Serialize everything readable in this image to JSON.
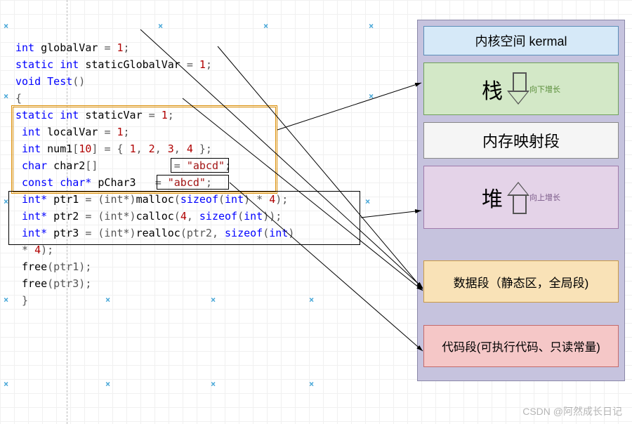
{
  "code": {
    "l1_kw1": "int",
    "l1_var": " globalVar ",
    "l1_eq": "=",
    "l1_num": " 1",
    "l1_semi": ";",
    "l2_kw1": "static int",
    "l2_var": " staticGlobalVar ",
    "l2_eq": "=",
    "l2_num": " 1",
    "l2_semi": ";",
    "l3_kw": "void ",
    "l3_fn": "Test",
    "l3_par": "()",
    "l4_brace": "{",
    "l5_kw": "static int",
    "l5_var": " staticVar ",
    "l5_eq": "=",
    "l5_num": " 1",
    "l5_semi": ";",
    "l6_kw": " int",
    "l6_var": " localVar ",
    "l6_eq": "=",
    "l6_num": " 1",
    "l6_semi": ";",
    "l7_kw": " int",
    "l7_var": " num1",
    "l7_br": "[",
    "l7_sz": "10",
    "l7_br2": "] ",
    "l7_eq": "=",
    "l7_op": " { ",
    "l7_n1": "1",
    "l7_c": ", ",
    "l7_n2": "2",
    "l7_n3": "3",
    "l7_n4": "4",
    "l7_cl": " };",
    "l8_kw": " char",
    "l8_var": " char2",
    "l8_br": "[]            ",
    "l8_eq": "=",
    "l8_str": " \"abcd\"",
    "l8_semi": ";",
    "l9_kw": " const char*",
    "l9_var": " pChar3   ",
    "l9_eq": "=",
    "l9_str": " \"abcd\"",
    "l9_semi": ";",
    "l10_kw": " int*",
    "l10_var": " ptr1 ",
    "l10_eq": "=",
    "l10_cast": " (int*)",
    "l10_fn": "malloc",
    "l10_op": "(",
    "l10_sz": "sizeof",
    "l10_op2": "(",
    "l10_ty": "int",
    "l10_cl": ") * ",
    "l10_n": "4",
    "l10_end": ");",
    "l11_kw": " int*",
    "l11_var": " ptr2 ",
    "l11_eq": "=",
    "l11_cast": " (int*)",
    "l11_fn": "calloc",
    "l11_op": "(",
    "l11_n": "4",
    "l11_c": ", ",
    "l11_sz": "sizeof",
    "l11_op2": "(",
    "l11_ty": "int",
    "l11_end": "));",
    "l12_kw": " int*",
    "l12_var": " ptr3 ",
    "l12_eq": "=",
    "l12_cast": " (int*)",
    "l12_fn": "realloc",
    "l12_op": "(ptr2, ",
    "l12_sz": "sizeof",
    "l12_op2": "(",
    "l12_ty": "int",
    "l12_cl": ")",
    "l13_txt": " * ",
    "l13_n": "4",
    "l13_end": ");",
    "l14_fn": " free",
    "l14_arg": "(ptr1);",
    "l15_fn": " free",
    "l15_arg": "(ptr3);",
    "l16_brace": " }"
  },
  "mem": {
    "kernel": "内核空间   kermal",
    "stack": "栈",
    "stack_grow": "向下增长",
    "mmap": "内存映射段",
    "heap": "堆",
    "heap_grow": "向上增长",
    "data": "数据段（静态区，全局段)",
    "code": "代码段(可执行代码、只读常量)"
  },
  "arrows": [
    {
      "from": "globalVar",
      "to": "data"
    },
    {
      "from": "staticGlobalVar",
      "to": "data"
    },
    {
      "from": "staticVar",
      "to": "data"
    },
    {
      "from": "localVar-box",
      "to": "stack"
    },
    {
      "from": "abcd-const",
      "to": "code"
    },
    {
      "from": "malloc-box",
      "to": "heap"
    }
  ],
  "watermark": "CSDN @阿然成长日记"
}
